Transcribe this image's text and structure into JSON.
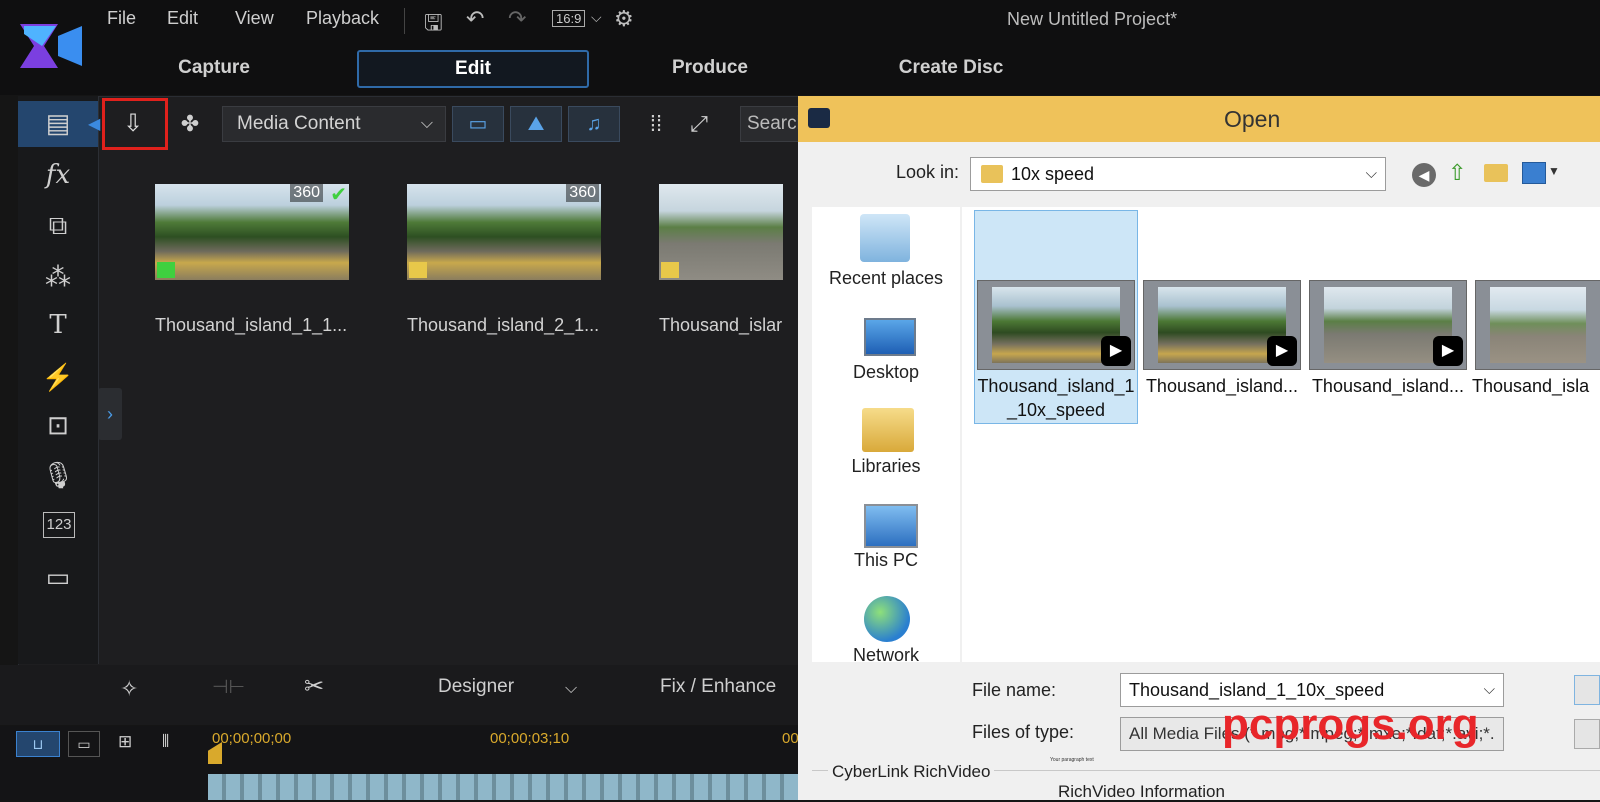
{
  "menu": [
    "File",
    "Edit",
    "View",
    "Playback"
  ],
  "aspect_ratio": "16:9",
  "project_title": "New Untitled Project*",
  "mode_tabs": [
    "Capture",
    "Edit",
    "Produce",
    "Create Disc"
  ],
  "active_tab": "Edit",
  "library": {
    "dropdown": "Media Content",
    "search_placeholder": "Search",
    "items": [
      {
        "label": "Thousand_island_1_1...",
        "badge": "360"
      },
      {
        "label": "Thousand_island_2_1...",
        "badge": "360"
      },
      {
        "label": "Thousand_islar",
        "badge": ""
      }
    ]
  },
  "rail_icons": [
    "media-room-icon",
    "fx-icon",
    "pip-icon",
    "particle-icon",
    "title-icon",
    "transition-icon",
    "audio-mix-icon",
    "voice-over-icon",
    "chapter-icon",
    "subtitle-icon"
  ],
  "edit_tools": {
    "designer": "Designer",
    "fix_enhance": "Fix / Enhance"
  },
  "timeline": {
    "tc_start": "00;00;00;00",
    "tc_mid": "00;00;03;10",
    "tc_end": "00"
  },
  "dialog": {
    "title": "Open",
    "look_in_label": "Look in:",
    "look_in_value": "10x speed",
    "places": [
      "Recent places",
      "Desktop",
      "Libraries",
      "This PC",
      "Network"
    ],
    "files": [
      {
        "line1": "Thousand_island_1",
        "line2": "_10x_speed",
        "selected": true
      },
      {
        "line1": "Thousand_island...",
        "line2": "",
        "selected": false
      },
      {
        "line1": "Thousand_island...",
        "line2": "",
        "selected": false
      },
      {
        "line1": "Thousand_isla",
        "line2": "",
        "selected": false
      }
    ],
    "file_name_label": "File name:",
    "file_name_value": "Thousand_island_1_10x_speed",
    "files_type_label": "Files of type:",
    "files_type_value": "All Media Files (*.mpg;*.mpeg;*.mxe;*.dat;*.avi;*.",
    "richvideo_group": "CyberLink RichVideo",
    "richvideo_info": "RichVideo Information"
  },
  "overlay": {
    "watermark": "pcprogs.org",
    "tiny_text": "Your paragraph text"
  },
  "colors": {
    "accent": "#2f6aa8",
    "highlight": "#e0211c",
    "dialog_title": "#efc25a",
    "watermark": "#e8262a"
  }
}
